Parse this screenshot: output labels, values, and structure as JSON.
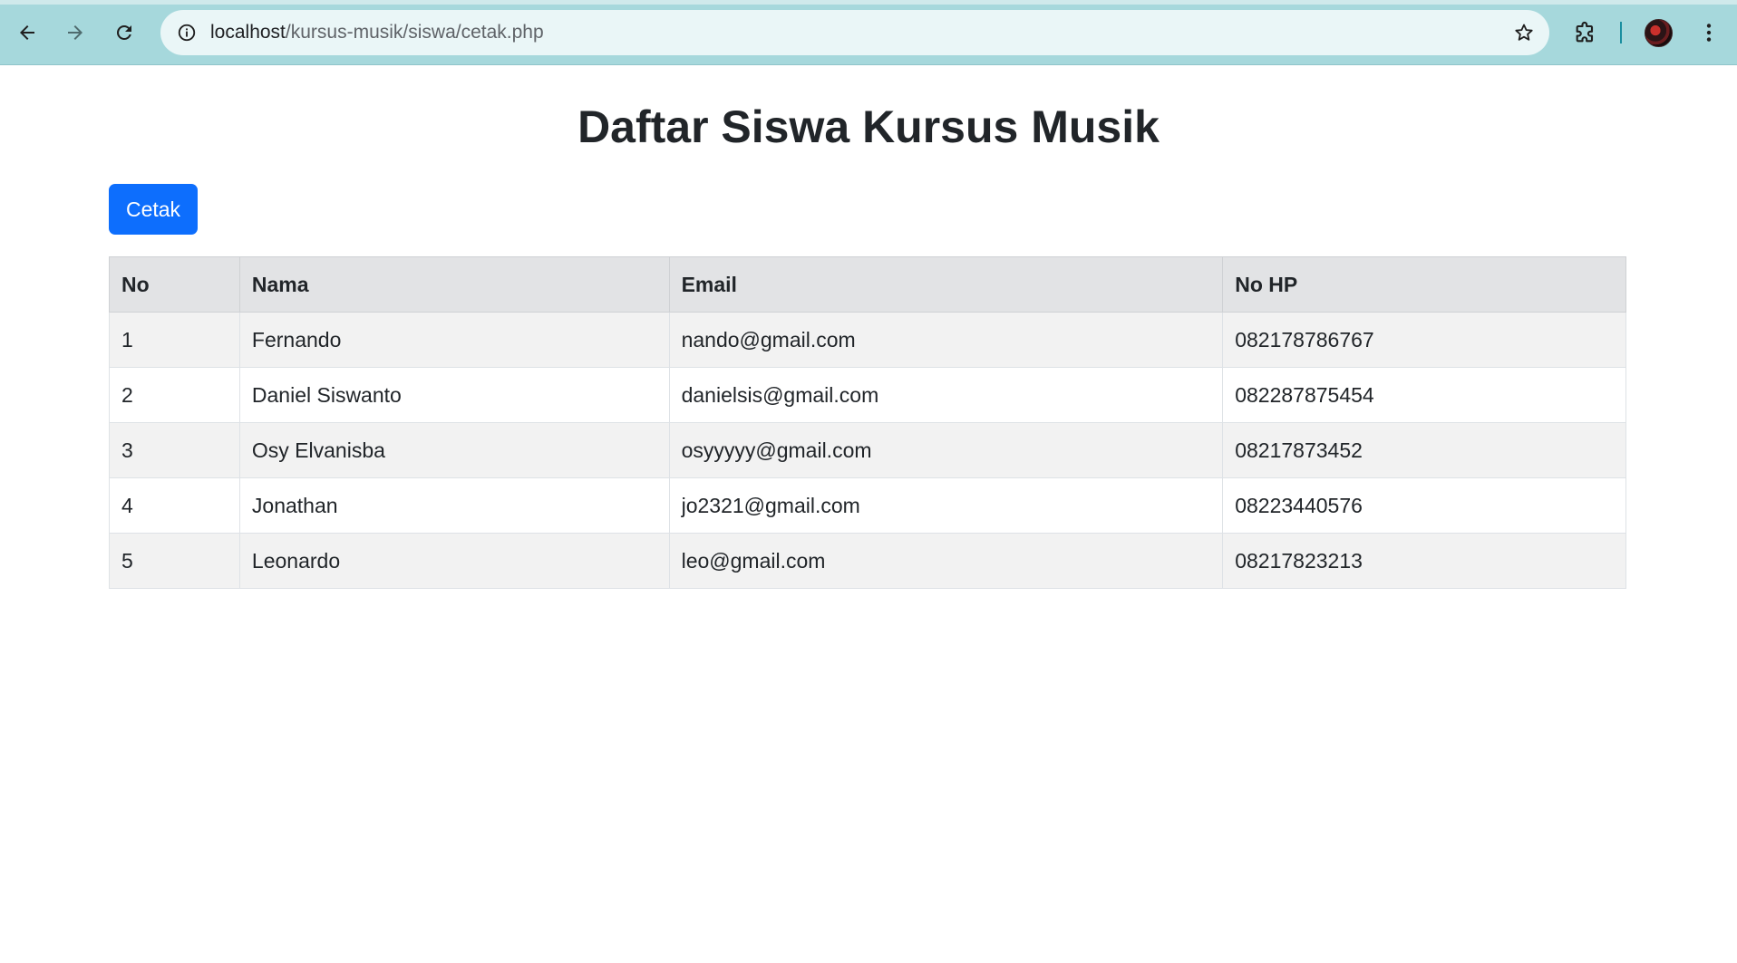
{
  "browser": {
    "url_host": "localhost",
    "url_path": "/kursus-musik/siswa/cetak.php",
    "icons": [
      "back-icon",
      "forward-icon",
      "reload-icon",
      "site-info-icon",
      "bookmark-star-icon",
      "extensions-icon",
      "profile-avatar",
      "more-menu-icon"
    ]
  },
  "page": {
    "title": "Daftar Siswa Kursus Musik",
    "print_button": "Cetak"
  },
  "table": {
    "headers": [
      "No",
      "Nama",
      "Email",
      "No HP"
    ],
    "rows": [
      [
        "1",
        "Fernando",
        "nando@gmail.com",
        "082178786767"
      ],
      [
        "2",
        "Daniel Siswanto",
        "danielsis@gmail.com",
        "082287875454"
      ],
      [
        "3",
        "Osy Elvanisba",
        "osyyyyy@gmail.com",
        "08217873452"
      ],
      [
        "4",
        "Jonathan",
        "jo2321@gmail.com",
        "08223440576"
      ],
      [
        "5",
        "Leonardo",
        "leo@gmail.com",
        "08217823213"
      ]
    ]
  },
  "colors": {
    "chrome_bg": "#a6d8dc",
    "omnibox_bg": "#eaf6f7",
    "primary_button": "#0d6efd",
    "table_header_bg": "#e2e3e5",
    "table_stripe_bg": "#f2f2f2"
  }
}
